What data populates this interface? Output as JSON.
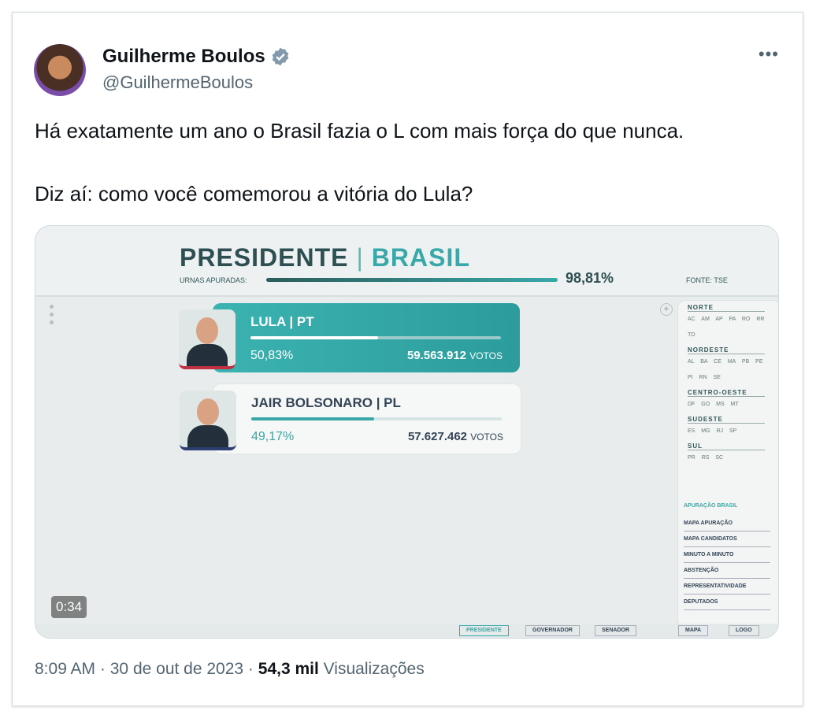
{
  "tweet": {
    "display_name": "Guilherme Boulos",
    "handle": "@GuilhermeBoulos",
    "text_line1": "Há exatamente um ano o Brasil fazia o L com mais força do que nunca.",
    "text_line2": "Diz aí: como você comemorou a vitória do Lula?",
    "time": "8:09 AM",
    "date": "30 de out de 2023",
    "views_count": "54,3 mil",
    "views_label": "Visualizações",
    "separator": "·",
    "more_glyph": "•••",
    "verified_color": "#829aab"
  },
  "video": {
    "duration": "0:34",
    "title": "PRESIDENTE",
    "country": "BRASIL",
    "urnas_label": "URNAS APURADAS:",
    "urnas_pct": "98,81%",
    "urnas_fraction": 0.9881,
    "fonte": "FONTE: TSE",
    "candidates": [
      {
        "name": "LULA",
        "party": "PT",
        "pct": "50,83%",
        "fraction": 0.5083,
        "votes": "59.563.912",
        "votes_label": "VOTOS"
      },
      {
        "name": "JAIR BOLSONARO",
        "party": "PL",
        "pct": "49,17%",
        "fraction": 0.4917,
        "votes": "57.627.462",
        "votes_label": "VOTOS"
      }
    ],
    "regions": [
      {
        "name": "NORTE",
        "states": "AC AM AP PA RO RR TO"
      },
      {
        "name": "NORDESTE",
        "states": "AL BA CE MA PB PE PI RN SE"
      },
      {
        "name": "CENTRO-OESTE",
        "states": "DF GO MS MT"
      },
      {
        "name": "SUDESTE",
        "states": "ES MG RJ SP"
      },
      {
        "name": "SUL",
        "states": "PR RS SC"
      }
    ],
    "menu_title": "APURAÇÃO BRASIL",
    "menu_items": [
      "MAPA APURAÇÃO",
      "MAPA CANDIDATOS",
      "MINUTO A MINUTO",
      "ABSTENÇÃO",
      "REPRESENTATIVIDADE",
      "DEPUTADOS"
    ],
    "bottom_tabs": [
      "PRESIDENTE",
      "GOVERNADOR",
      "SENADOR",
      "MAPA",
      "LOGO"
    ]
  }
}
